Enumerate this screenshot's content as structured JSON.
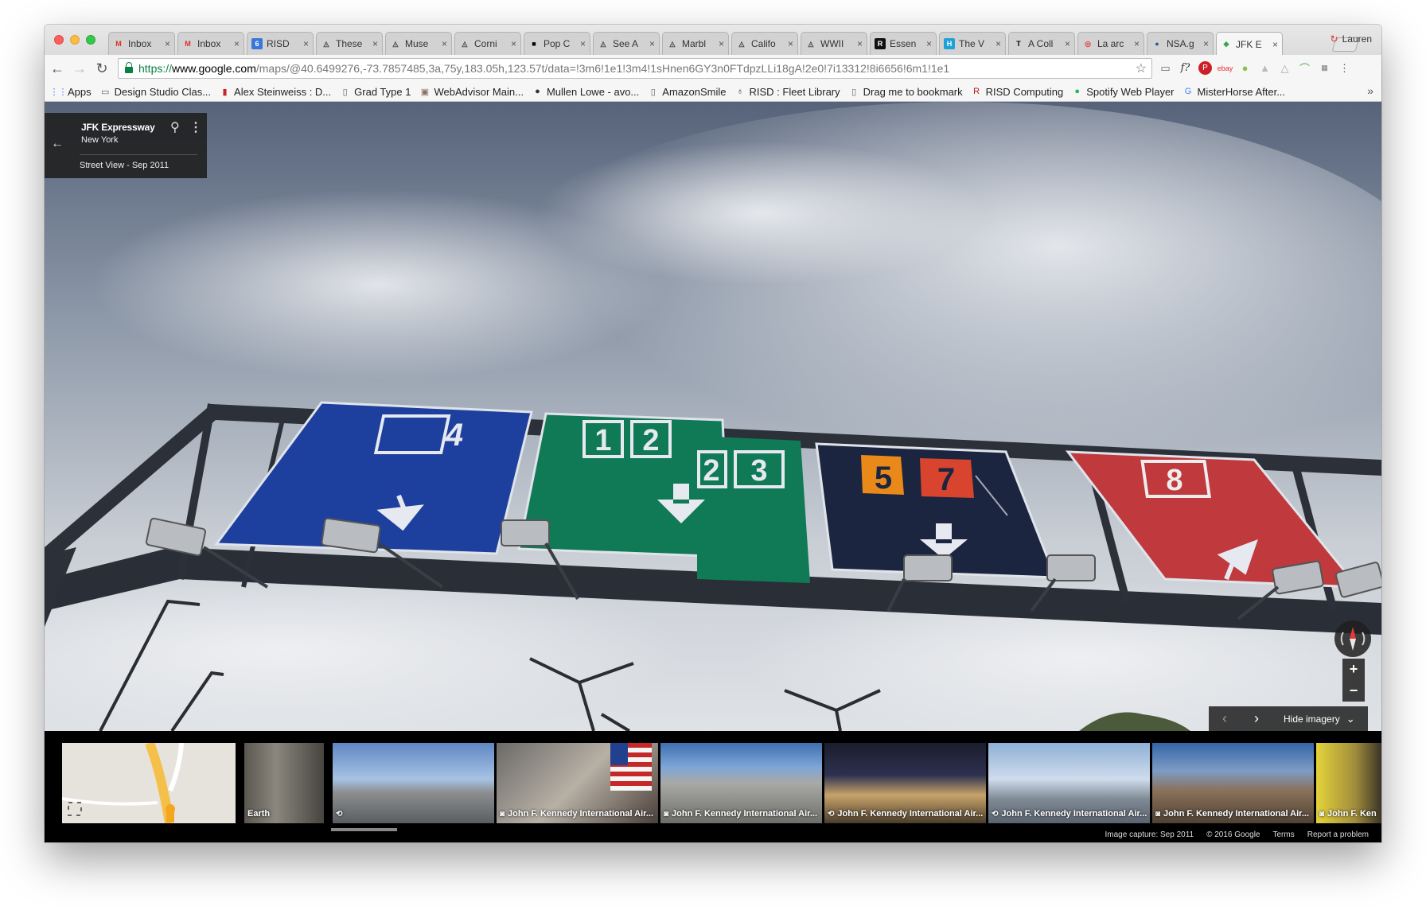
{
  "browser": {
    "tabs": [
      {
        "label": "Inbox",
        "icon": "gmail-icon",
        "fav": "M",
        "color": "#d93025",
        "bg": "transparent"
      },
      {
        "label": "Inbox",
        "icon": "gmail-icon",
        "fav": "M",
        "color": "#d93025",
        "bg": "transparent"
      },
      {
        "label": "RISD",
        "icon": "risd-calendar-icon",
        "fav": "6",
        "color": "#ffffff",
        "bg": "#3a78d8"
      },
      {
        "label": "These",
        "icon": "arena-icon",
        "fav": "◬",
        "color": "#444444",
        "bg": "transparent"
      },
      {
        "label": "Muse",
        "icon": "arena-icon",
        "fav": "◬",
        "color": "#444444",
        "bg": "transparent"
      },
      {
        "label": "Corni",
        "icon": "arena-icon",
        "fav": "◬",
        "color": "#444444",
        "bg": "transparent"
      },
      {
        "label": "Pop C",
        "icon": "square-icon",
        "fav": "■",
        "color": "#000000",
        "bg": "transparent"
      },
      {
        "label": "See A",
        "icon": "arena-icon",
        "fav": "◬",
        "color": "#444444",
        "bg": "transparent"
      },
      {
        "label": "Marbl",
        "icon": "arena-icon",
        "fav": "◬",
        "color": "#444444",
        "bg": "transparent"
      },
      {
        "label": "Califo",
        "icon": "arena-icon",
        "fav": "◬",
        "color": "#444444",
        "bg": "transparent"
      },
      {
        "label": "WWII",
        "icon": "arena-icon",
        "fav": "◬",
        "color": "#444444",
        "bg": "transparent"
      },
      {
        "label": "Essen",
        "icon": "risd-icon",
        "fav": "R",
        "color": "#ffffff",
        "bg": "#111111"
      },
      {
        "label": "The V",
        "icon": "h-icon",
        "fav": "H",
        "color": "#ffffff",
        "bg": "#1da1d8"
      },
      {
        "label": "A Coll",
        "icon": "nyt-icon",
        "fav": "T",
        "color": "#000000",
        "bg": "transparent"
      },
      {
        "label": "La arc",
        "icon": "target-icon",
        "fav": "◎",
        "color": "#e53935",
        "bg": "transparent"
      },
      {
        "label": "NSA.g",
        "icon": "globe-icon",
        "fav": "●",
        "color": "#2b5d9b",
        "bg": "transparent"
      },
      {
        "label": "JFK E",
        "icon": "google-maps-icon",
        "fav": "◆",
        "color": "#34a853",
        "bg": "transparent"
      }
    ],
    "profile_name": "Lauren",
    "url": {
      "scheme": "https://",
      "host": "www.google.com",
      "path": "/maps/@40.6499276,-73.7857485,3a,75y,183.05h,123.57t/data=!3m6!1e1!3m4!1sHnen6GY3n0FTdpzLLi18gA!2e0!7i13312!8i6656!6m1!1e1"
    },
    "bookmarks": [
      {
        "label": "Apps",
        "icon": "apps-grid-icon",
        "glyph": "⋮⋮",
        "color": "#4285f4"
      },
      {
        "label": "Design Studio Clas...",
        "icon": "desk-icon",
        "glyph": "▭",
        "color": "#555555"
      },
      {
        "label": "Alex Steinweiss : D...",
        "icon": "book-icon",
        "glyph": "▮",
        "color": "#c62828"
      },
      {
        "label": "Grad Type 1",
        "icon": "page-icon",
        "glyph": "▯",
        "color": "#666666"
      },
      {
        "label": "WebAdvisor Main...",
        "icon": "webadvisor-icon",
        "glyph": "▣",
        "color": "#8d6e63"
      },
      {
        "label": "Mullen Lowe - avo...",
        "icon": "mullen-icon",
        "glyph": "●",
        "color": "#333333"
      },
      {
        "label": "AmazonSmile",
        "icon": "page-icon",
        "glyph": "▯",
        "color": "#666666"
      },
      {
        "label": "RISD : Fleet Library",
        "icon": "fleet-icon",
        "glyph": "♁",
        "color": "#333333"
      },
      {
        "label": "Drag me to bookmark",
        "icon": "page-icon",
        "glyph": "▯",
        "color": "#666666"
      },
      {
        "label": "RISD Computing",
        "icon": "risd-icon",
        "glyph": "R",
        "color": "#b71c1c"
      },
      {
        "label": "Spotify Web Player",
        "icon": "spotify-icon",
        "glyph": "●",
        "color": "#1db954"
      },
      {
        "label": "MisterHorse After...",
        "icon": "google-icon",
        "glyph": "G",
        "color": "#4285f4"
      }
    ]
  },
  "infocard": {
    "title": "JFK Expressway",
    "subtitle": "New York",
    "date": "Street View - Sep 2011"
  },
  "controls": {
    "hide_label": "Hide imagery"
  },
  "scene": {
    "sign_numbers": [
      "4",
      "1",
      "2",
      "2",
      "3",
      "5",
      "7",
      "8"
    ]
  },
  "filmstrip": {
    "items": [
      {
        "type": "map",
        "caption": "",
        "icon": ""
      },
      {
        "type": "earth",
        "caption": "Earth",
        "icon": ""
      },
      {
        "type": "streetview",
        "caption": "",
        "icon": "360-icon"
      },
      {
        "type": "photo",
        "caption": "John F. Kennedy International Air...",
        "icon": "camera-icon"
      },
      {
        "type": "photo",
        "caption": "John F. Kennedy International Air...",
        "icon": "camera-icon"
      },
      {
        "type": "photo",
        "caption": "John F. Kennedy International Air...",
        "icon": "360-icon"
      },
      {
        "type": "photo",
        "caption": "John F. Kennedy International Air...",
        "icon": "360-icon"
      },
      {
        "type": "photo",
        "caption": "John F. Kennedy International Air...",
        "icon": "camera-icon"
      },
      {
        "type": "photo",
        "caption": "John F. Ken",
        "icon": "camera-icon"
      }
    ]
  },
  "footer": {
    "capture": "Image capture: Sep 2011",
    "copyright": "© 2016 Google",
    "terms": "Terms",
    "report": "Report a problem"
  },
  "colors": {
    "sign_blue": "#1d3f9e",
    "sign_green": "#0f7a55",
    "sign_navy": "#1c2540",
    "sign_red": "#c0393d",
    "sign_orange": "#e8891a",
    "sign_redsquare": "#d8442e"
  }
}
